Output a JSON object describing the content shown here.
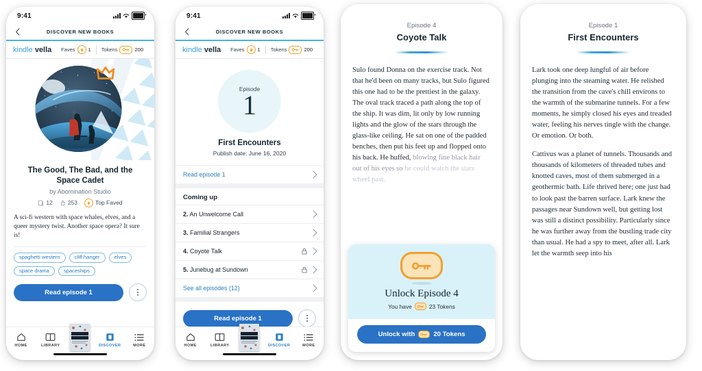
{
  "status_bar": {
    "time": "9:41",
    "signal_icon": "signal-bars-icon",
    "wifi_icon": "wifi-icon",
    "battery_icon": "battery-icon"
  },
  "nav": {
    "title": "DISCOVER NEW BOOKS",
    "back_icon": "back-chevron-icon"
  },
  "vella_header": {
    "brand_kindle": "kindle",
    "brand_vella": "vella",
    "faves_label": "Faves",
    "faves_value": "1",
    "faves_icon": "fave-badge-icon",
    "tokens_label": "Tokens",
    "tokens_value": "200",
    "tokens_icon": "token-key-icon"
  },
  "book": {
    "title": "The Good, The Bad, and the Space Cadet",
    "byline": "by Abomination Studio",
    "crown_icon": "crown-badge-icon",
    "cover_icon": "book-cover-art",
    "stats": {
      "episodes_icon": "episodes-icon",
      "episodes_count": "12",
      "likes_icon": "thumbs-up-icon",
      "likes_count": "253",
      "badge_icon": "top-faved-badge-icon",
      "badge_label": "Top Faved"
    },
    "blurb": "A sci-fi western with space whales, elves, and a queer mystery twist. Another space opera? It sure is!",
    "tags": [
      "spaghetti western",
      "cliff hanger",
      "elves",
      "space drama",
      "spaceships"
    ],
    "read_button": "Read episode 1",
    "more_icon": "kebab-menu-icon"
  },
  "tabbar": {
    "items": [
      {
        "label": "HOME",
        "icon": "home-icon"
      },
      {
        "label": "LIBRARY",
        "icon": "library-book-icon"
      },
      {
        "label": "DISCOVER",
        "icon": "discover-icon"
      },
      {
        "label": "MORE",
        "icon": "more-list-icon"
      }
    ],
    "featured_cover": "feather-thief-cover",
    "featured_cover_title": "FEATHER THIEF"
  },
  "episode_detail": {
    "episode_word": "Episode",
    "episode_number": "1",
    "title": "First Encounters",
    "publish_date": "Publish date: June 16, 2020",
    "read_link": "Read episode 1",
    "coming_up_header": "Coming up",
    "upcoming": [
      {
        "num": "2.",
        "title": "An Unwelcome Call",
        "locked": false
      },
      {
        "num": "3.",
        "title": "Familial Strangers",
        "locked": false
      },
      {
        "num": "4.",
        "title": "Coyote Talk",
        "locked": true
      },
      {
        "num": "5.",
        "title": "Junebug at Sundown",
        "locked": true
      }
    ],
    "see_all": "See all episodes (12)",
    "read_button": "Read episode 1",
    "more_icon": "kebab-menu-icon"
  },
  "reader_locked": {
    "episode_label": "Episode 4",
    "title": "Coyote Talk",
    "paragraph_solid": "Sulo found Donna on the exercise track. Not that he'd been on many tracks, but Sulo figured this one had to be the prettiest in the galaxy. The oval track traced a path along the top of the ship. It was dim, lit only by low running lights and the glow of the stars through the glass-like ceiling. He sat on one of the padded benches, then put his feet up and flopped onto his back. He huffed,",
    "paragraph_fade1": "blowing fine black hair out of his eyes so",
    "paragraph_fade2": "he could watch the stars wheel past.",
    "unlock": {
      "key_icon": "big-key-icon",
      "title": "Unlock Episode 4",
      "balance_prefix": "You have",
      "balance_icon": "token-key-icon",
      "balance_text": "23 Tokens",
      "button_prefix": "Unlock with",
      "button_icon": "token-key-icon",
      "button_text": "20 Tokens"
    }
  },
  "reader_open": {
    "episode_label": "Episode 1",
    "title": "First Encounters",
    "paragraphs": [
      "Lark took one deep lungful of air before plunging into the steaming water. He relished the transition from the cave's chill environs to the warmth of the submarine tunnels. For a few moments, he simply closed his eyes and treaded water, feeling his nerves tingle with the change. Or emotion. Or both.",
      "Cattivus was a planet of tunnels. Thousands and thousands of kilometers of threaded tubes and knotted caves, most of them submerged in a geothermic bath. Life thrived here; one just had to look past the barren surface. Lark knew the passages near Sundown well, but getting lost was still a distinct possibility. Particularly since he was further away from the bustling trade city than usual. He had a spy to meet, after all. Lark let the warmth seep into his"
    ]
  },
  "colors": {
    "accent_blue": "#2a72c5",
    "link_blue": "#2b7fc0",
    "rule_blue": "#44b3e3",
    "orange": "#f0a02a",
    "pale_blue": "#e8f6fa",
    "unlock_bg": "#d9f2f9",
    "dark_text": "#16252f"
  }
}
